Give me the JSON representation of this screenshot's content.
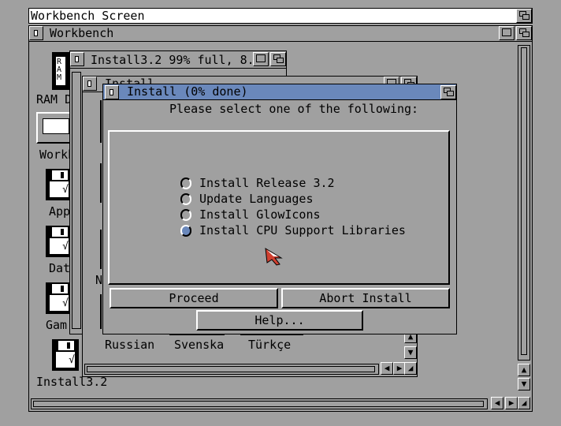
{
  "screen": {
    "title": "Workbench Screen"
  },
  "workbench_window": {
    "title": "Workbench"
  },
  "disk_window": {
    "title": "Install3.2  99% full, 8."
  },
  "install_drawer": {
    "title": "Install"
  },
  "languages": [
    "Russian",
    "Svenska",
    "Türkçe"
  ],
  "dialog": {
    "title": "Install (0% done)",
    "prompt": "Please select one of the following:",
    "options": [
      {
        "label": "Install Release 3.2",
        "selected": false
      },
      {
        "label": "Update Languages",
        "selected": false
      },
      {
        "label": "Install GlowIcons",
        "selected": false
      },
      {
        "label": "Install CPU Support Libraries",
        "selected": true
      }
    ],
    "proceed_label": "Proceed",
    "abort_label": "Abort Install",
    "help_label": "Help..."
  },
  "icons": {
    "ram": {
      "label": "RAM D",
      "glyph": "RAM"
    },
    "workbench": {
      "label": "Workb"
    },
    "apps": {
      "label": "App"
    },
    "data": {
      "label": "Dat"
    },
    "games": {
      "label": "Gam"
    },
    "install": {
      "label": "Install3.2"
    },
    "partial_n": {
      "label": "N"
    }
  },
  "colors": {
    "background": "#a0a0a0",
    "accent": "#6a88bb",
    "pointer": "#d04030"
  }
}
